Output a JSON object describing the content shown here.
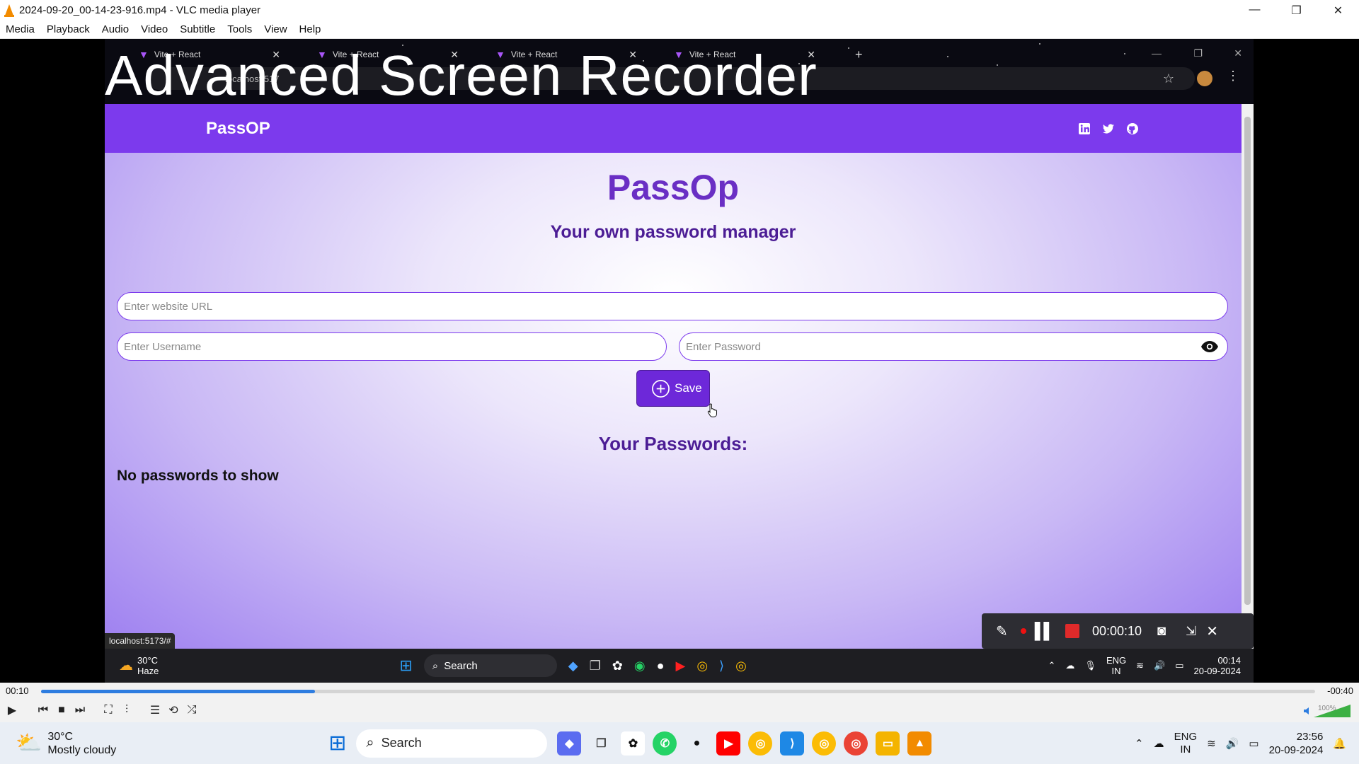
{
  "window": {
    "title": "2024-09-20_00-14-23-916.mp4 - VLC media player",
    "controls": [
      "—",
      "❐",
      "✕"
    ]
  },
  "menu": [
    "Media",
    "Playback",
    "Audio",
    "Video",
    "Subtitle",
    "Tools",
    "View",
    "Help"
  ],
  "recording": {
    "overlay_title": "Advanced Screen Recorder",
    "browser": {
      "tabs": [
        "Vite + React",
        "Vite + React",
        "Vite + React",
        "Vite + React"
      ],
      "url": "localhost:517"
    },
    "app": {
      "nav_brand": "PassOP",
      "heading": "PassOp",
      "subheading": "Your own password manager",
      "url_placeholder": "Enter website URL",
      "username_placeholder": "Enter Username",
      "password_placeholder": "Enter Password",
      "save_label": "Save",
      "passwords_heading": "Your Passwords:",
      "empty_text": "No passwords to show"
    },
    "status_url": "localhost:5173/#",
    "recorder_time": "00:00:10",
    "inner_taskbar": {
      "temp": "30°C",
      "condition": "Haze",
      "search": "Search",
      "lang": "ENG",
      "region": "IN",
      "time": "00:14",
      "date": "20-09-2024"
    }
  },
  "player": {
    "elapsed": "00:10",
    "remaining": "-00:40",
    "progress_fraction": 0.215,
    "volume": "100%"
  },
  "taskbar": {
    "temp": "30°C",
    "condition": "Mostly cloudy",
    "search": "Search",
    "lang": "ENG",
    "region": "IN",
    "time": "23:56",
    "date": "20-09-2024"
  },
  "colors": {
    "accent": "#7c3aed",
    "heading": "#6a2fc4",
    "progress": "#2e7de0"
  }
}
